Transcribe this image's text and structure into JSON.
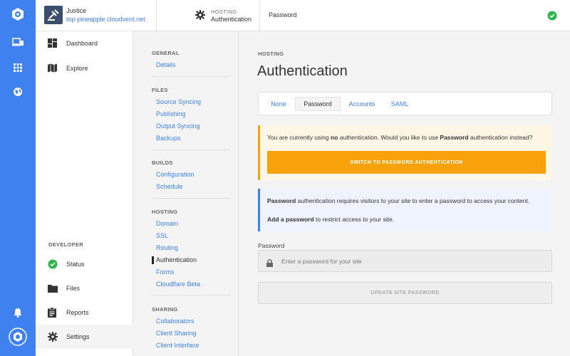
{
  "rail": {
    "icons": [
      "cloudvent-logo-icon",
      "devices-icon",
      "apps-grid-icon",
      "globe-icon",
      "bell-icon",
      "account-avatar-icon"
    ]
  },
  "topbar": {
    "site_name": "Justice",
    "site_url": "top-pineapple.cloudvent.net",
    "crumb_section": "HOSTING",
    "crumb_page": "Authentication",
    "crumb_current": "Password",
    "status_icon": "check-circle-icon"
  },
  "nav": {
    "items": [
      {
        "label": "Dashboard",
        "icon": "dashboard-icon"
      },
      {
        "label": "Explore",
        "icon": "map-icon"
      }
    ],
    "developer_title": "DEVELOPER",
    "developer_items": [
      {
        "label": "Status",
        "icon": "check-circle-icon"
      },
      {
        "label": "Files",
        "icon": "folder-icon"
      },
      {
        "label": "Reports",
        "icon": "clipboard-icon"
      },
      {
        "label": "Settings",
        "icon": "gear-icon"
      }
    ]
  },
  "subnav": {
    "groups": [
      {
        "title": "GENERAL",
        "links": [
          "Details"
        ]
      },
      {
        "title": "FILES",
        "links": [
          "Source Syncing",
          "Publishing",
          "Output Syncing",
          "Backups"
        ]
      },
      {
        "title": "BUILDS",
        "links": [
          "Configuration",
          "Schedule"
        ]
      },
      {
        "title": "HOSTING",
        "links": [
          "Domain",
          "SSL",
          "Routing",
          "Authentication",
          "Forms",
          "Cloudflare Beta"
        ]
      },
      {
        "title": "SHARING",
        "links": [
          "Collaborators",
          "Client Sharing",
          "Client Interface"
        ]
      }
    ]
  },
  "main": {
    "eyebrow": "HOSTING",
    "title": "Authentication",
    "tabs": [
      "None",
      "Password",
      "Accounts",
      "SAML"
    ],
    "active_tab": "Password",
    "warning": {
      "pre": "You are currently using ",
      "b1": "no",
      "mid": " authentication. Would you like to use ",
      "b2": "Password",
      "post": " authentication instead?",
      "button": "SWITCH TO PASSWORD AUTHENTICATION"
    },
    "info": {
      "b1": "Password",
      "line1": " authentication requires visitors to your site to enter a password to access your content.",
      "b2": "Add a password",
      "line2": " to restrict access to your site."
    },
    "password_label": "Password",
    "password_placeholder": "Enter a password for your site",
    "password_value": "",
    "update_button": "UPDATE SITE PASSWORD"
  },
  "colors": {
    "rail": "#3f82ef",
    "accent": "#3f82ef",
    "warning": "#f7a20a",
    "success": "#2eb84b"
  }
}
